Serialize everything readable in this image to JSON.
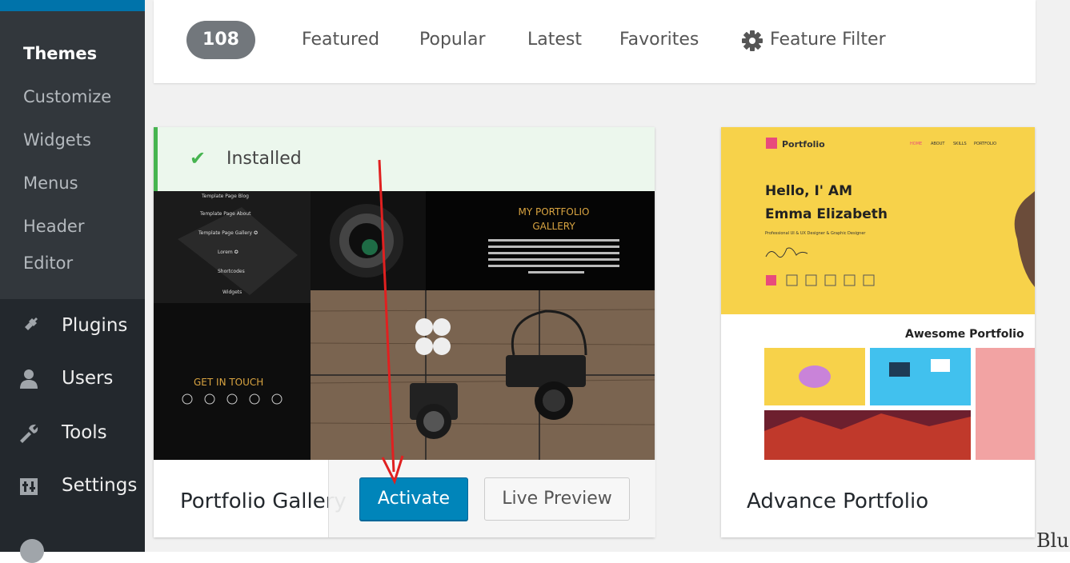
{
  "sidebar": {
    "submenu": {
      "current": "Themes",
      "items": [
        "Customize",
        "Widgets",
        "Menus",
        "Header",
        "Editor"
      ]
    },
    "menu": [
      {
        "label": "Plugins",
        "icon": "plugin-icon"
      },
      {
        "label": "Users",
        "icon": "users-icon"
      },
      {
        "label": "Tools",
        "icon": "tools-icon"
      },
      {
        "label": "Settings",
        "icon": "settings-icon"
      }
    ]
  },
  "filter_bar": {
    "count": "108",
    "links": [
      "Featured",
      "Popular",
      "Latest",
      "Favorites"
    ],
    "feature_filter": "Feature Filter"
  },
  "themes": [
    {
      "name": "Portfolio Gallery",
      "notice": "Installed",
      "activate_label": "Activate",
      "preview_label": "Live Preview",
      "screenshot": {
        "menu_items": [
          "Template Page Blog",
          "Template Page About",
          "Template Page Gallery ✪",
          "Lorem ✪",
          "Shortcodes",
          "Widgets"
        ],
        "heading": "MY PORTFOLIO\nGALLERY",
        "cta": "GET IN TOUCH"
      }
    },
    {
      "name": "Advance Portfolio",
      "screenshot": {
        "brand": "Portfolio",
        "nav": [
          "HOME",
          "ABOUT",
          "SKILLS",
          "PORTFOLIO"
        ],
        "hello": "Hello, I' AM",
        "person": "Emma Elizabeth",
        "tagline": "Professional UI & UX Designer & Graphic Designer",
        "section": "Awesome Portfolio"
      }
    }
  ],
  "watermark": "Blu",
  "colors": {
    "sidebar_bg": "#23282d",
    "submenu_bg": "#32373c",
    "primary_button": "#0085ba",
    "success_green": "#46b450",
    "annotation_arrow": "#e02020",
    "portfolio_yellow": "#f7d24a"
  }
}
